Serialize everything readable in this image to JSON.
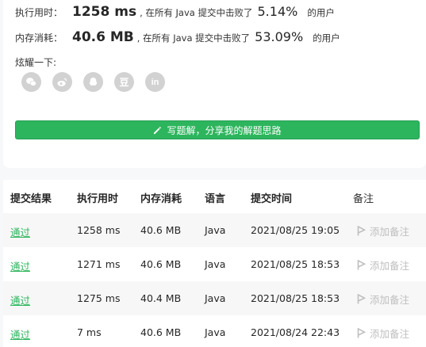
{
  "stats": {
    "time_label": "执行用时：",
    "time_value": "1258 ms",
    "time_mid": ", 在所有 Java 提交中击败了",
    "time_pct": "5.14%",
    "time_tail": "的用户",
    "mem_label": "内存消耗：",
    "mem_value": "40.6 MB",
    "mem_mid": ", 在所有 Java 提交中击败了",
    "mem_pct": "53.09%",
    "mem_tail": "的用户"
  },
  "share": {
    "label": "炫耀一下:",
    "icons": [
      "wechat-icon",
      "weibo-icon",
      "qq-icon",
      "douban-icon",
      "linkedin-icon"
    ],
    "douban_glyph": "豆",
    "linkedin_glyph": "in"
  },
  "write_button": {
    "label": "写题解，分享我的解题思路",
    "icon": "pencil-icon"
  },
  "table": {
    "headers": [
      "提交结果",
      "执行用时",
      "内存消耗",
      "语言",
      "提交时间",
      "备注"
    ],
    "rows": [
      {
        "result": "通过",
        "time": "1258 ms",
        "memory": "40.6 MB",
        "language": "Java",
        "submitted": "2021/08/25 19:05",
        "note": "添加备注"
      },
      {
        "result": "通过",
        "time": "1271 ms",
        "memory": "40.6 MB",
        "language": "Java",
        "submitted": "2021/08/25 18:53",
        "note": "添加备注"
      },
      {
        "result": "通过",
        "time": "1275 ms",
        "memory": "40.4 MB",
        "language": "Java",
        "submitted": "2021/08/25 18:53",
        "note": "添加备注"
      },
      {
        "result": "通过",
        "time": "7 ms",
        "memory": "40.6 MB",
        "language": "Java",
        "submitted": "2021/08/24 22:43",
        "note": "添加备注"
      }
    ]
  },
  "colors": {
    "accent_green": "#2db55d",
    "icon_gray": "#d2d2d2",
    "note_gray": "#bfbfbf"
  }
}
